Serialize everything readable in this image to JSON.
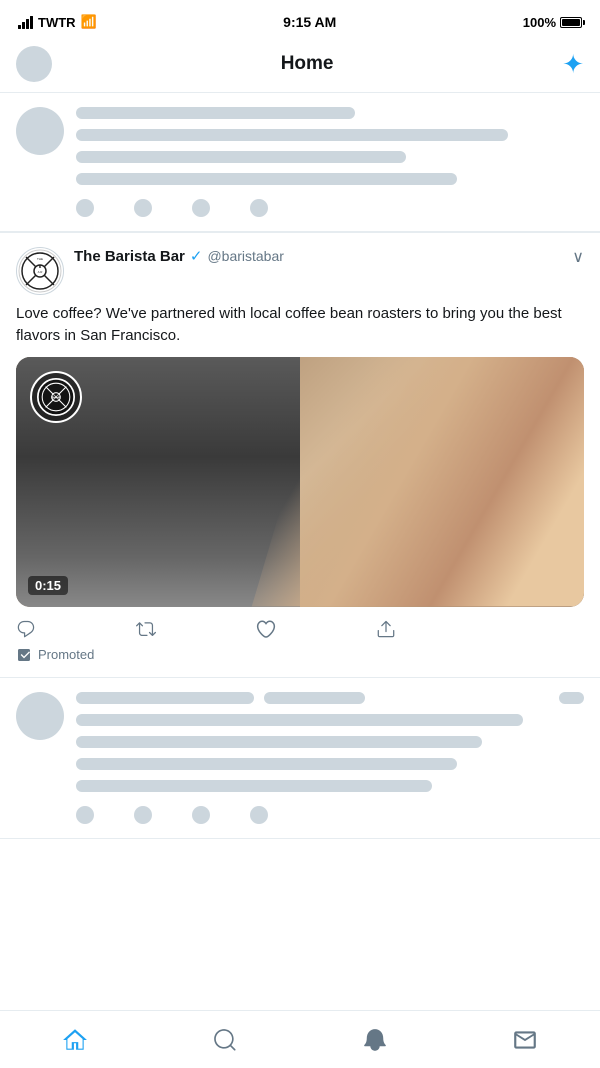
{
  "statusBar": {
    "carrier": "TWTR",
    "time": "9:15 AM",
    "battery": "100%",
    "wifi": true,
    "signal": true
  },
  "header": {
    "title": "Home",
    "sparkleTooltip": "What's new"
  },
  "skeletonTweet": {
    "lines": [
      0.85,
      0.65,
      0.75
    ]
  },
  "tweet": {
    "name": "The Barista Bar",
    "handle": "@baristabar",
    "verified": true,
    "text": "Love coffee? We've partnered with local coffee bean roasters to bring you the best flavors in San Francisco.",
    "video": {
      "duration": "0:15"
    },
    "actions": {
      "reply": "",
      "retweet": "",
      "like": "",
      "share": ""
    },
    "promoted": "Promoted"
  },
  "tabBar": {
    "home": "Home",
    "search": "Search",
    "notifications": "Notifications",
    "messages": "Messages"
  }
}
